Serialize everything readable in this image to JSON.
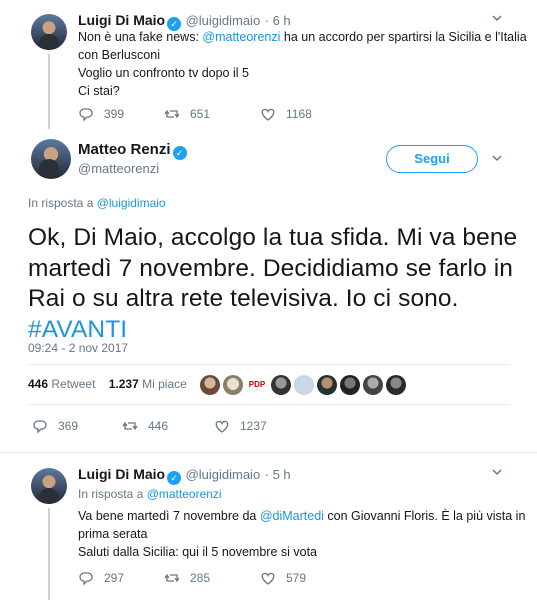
{
  "tweet1": {
    "name": "Luigi Di Maio",
    "handle": "@luigidimaio",
    "time": "· 6 h",
    "line1_prefix": "Non è una fake news: ",
    "line1_mention": "@matteorenzi",
    "line1_suffix": " ha un accordo per spartirsi la Sicilia e l'Italia",
    "line2": "con Berlusconi",
    "line3": "Voglio un confronto tv dopo il 5",
    "line4": "Ci stai?",
    "replies": "399",
    "retweets": "651",
    "likes": "1168"
  },
  "main_tweet": {
    "name": "Matteo Renzi",
    "handle": "@matteorenzi",
    "follow_label": "Segui",
    "reply_prefix": "In risposta a ",
    "reply_to": "@luigidimaio",
    "text_line1": "Ok, Di Maio, accolgo la tua sfida. Mi va bene",
    "text_line2": "martedì 7 novembre. Decididiamo se farlo in",
    "text_line3": "Rai o su altra rete televisiva. Io ci sono.",
    "hashtag": "#AVANTI",
    "timestamp": "09:24 - 2 nov 2017",
    "retweet_count": "446",
    "retweet_label": "Retweet",
    "like_count": "1.237",
    "like_label": "Mi piace",
    "replies": "369",
    "retweets": "446",
    "likes": "1237",
    "pdp_badge": "PDP"
  },
  "tweet3": {
    "name": "Luigi Di Maio",
    "handle": "@luigidimaio",
    "time": "· 5 h",
    "reply_prefix": "In risposta a ",
    "reply_to": "@matteorenzi",
    "line1_prefix": "Va bene martedì 7 novembre da ",
    "line1_mention": "@diMartedi",
    "line1_suffix": " con Giovanni Floris. È la più vista in",
    "line2": "prima serata",
    "line3": "Saluti dalla Sicilia: qui il 5 novembre si vota",
    "replies": "297",
    "retweets": "285",
    "likes": "579"
  },
  "colors": {
    "accent": "#1da1f2",
    "link": "#1b95e0",
    "muted": "#657786"
  }
}
